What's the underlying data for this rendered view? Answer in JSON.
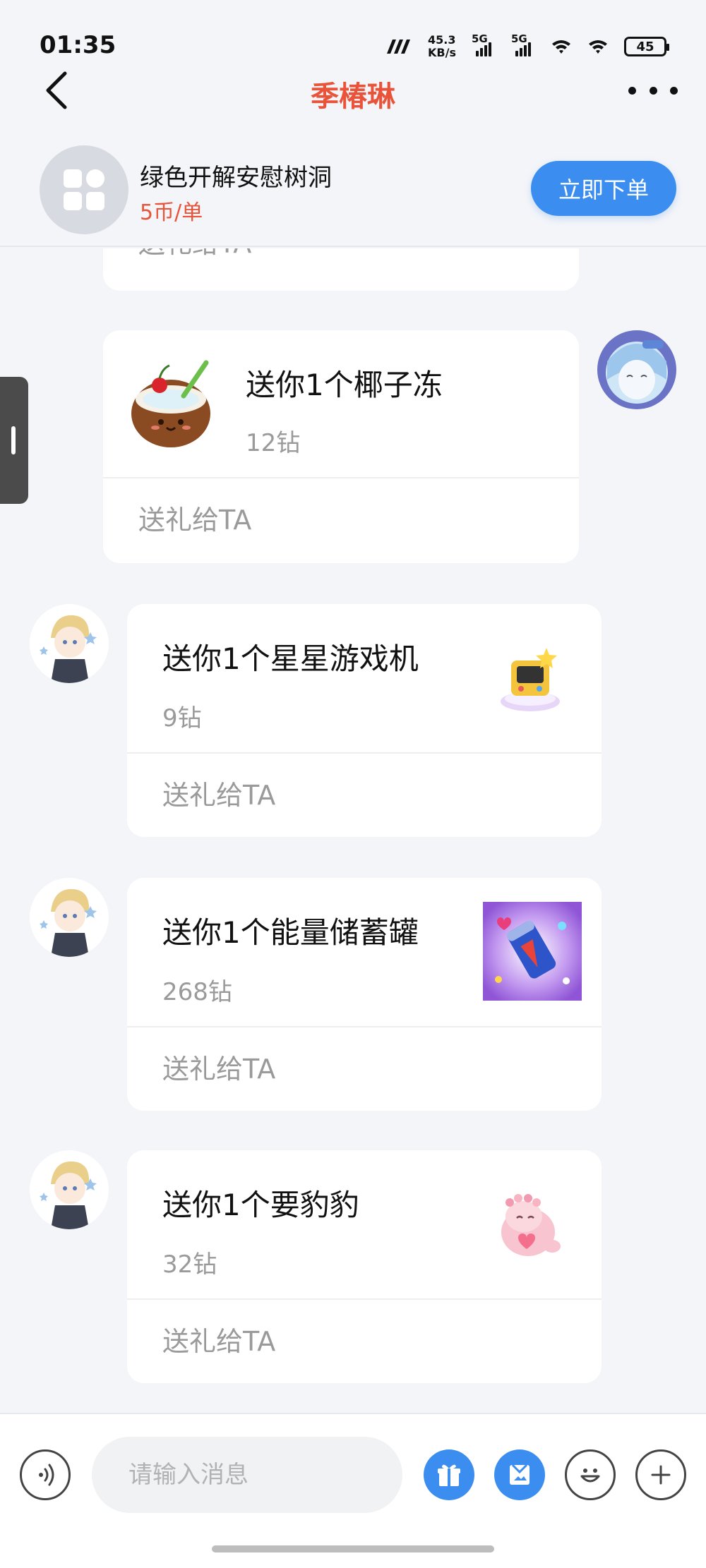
{
  "status_bar": {
    "time": "01:35",
    "net_speed_value": "45.3",
    "net_speed_unit": "KB/s",
    "sim1": "5G",
    "sim2": "5G",
    "battery": "45"
  },
  "header": {
    "title": "季椿琳"
  },
  "service": {
    "name": "绿色开解安慰树洞",
    "price": "5币/单",
    "order_button": "立即下单"
  },
  "messages": [
    {
      "partial": true,
      "action": "送礼给TA"
    },
    {
      "sender": "self",
      "gift_text": "送你1个椰子冻",
      "price": "12钻",
      "action": "送礼给TA",
      "gift_icon": "coconut-jelly-icon"
    },
    {
      "sender": "other",
      "gift_text": "送你1个星星游戏机",
      "price": "9钻",
      "action": "送礼给TA",
      "gift_icon": "star-game-console-icon"
    },
    {
      "sender": "other",
      "gift_text": "送你1个能量储蓄罐",
      "price": "268钻",
      "action": "送礼给TA",
      "gift_icon": "energy-can-icon"
    },
    {
      "sender": "other",
      "gift_text": "送你1个要豹豹",
      "price": "32钻",
      "action": "送礼给TA",
      "gift_icon": "hug-leopard-icon"
    }
  ],
  "input_bar": {
    "placeholder": "请输入消息"
  },
  "colors": {
    "accent_blue": "#3b8ef0",
    "title_red": "#e8533a",
    "background": "#f4f5f9"
  }
}
